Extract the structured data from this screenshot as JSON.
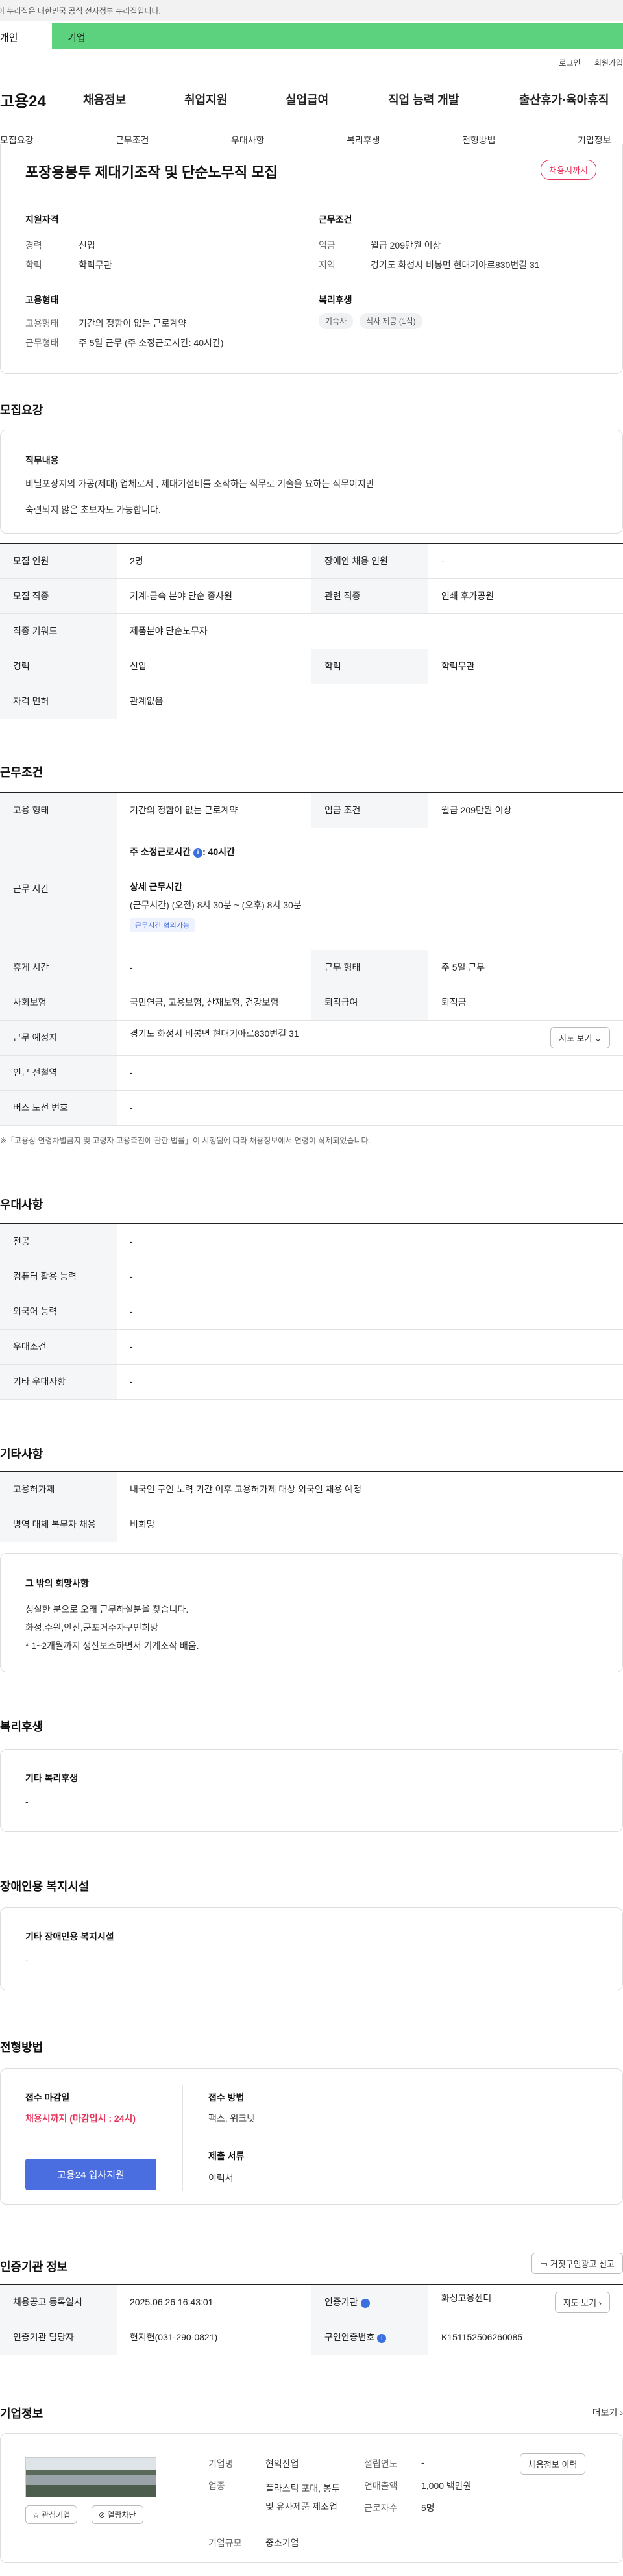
{
  "gov_banner": "이 누리집은 대한민국 공식 전자정부 누리집입니다.",
  "tabs": {
    "person": "개인",
    "company": "기업"
  },
  "util": {
    "login": "로그인",
    "join": "회원가입"
  },
  "logo": "고용24",
  "gnb": [
    "채용정보",
    "취업지원",
    "실업급여",
    "직업 능력 개발",
    "출산휴가·육아휴직"
  ],
  "subnav": [
    "모집요강",
    "근무조건",
    "우대사항",
    "복리후생",
    "전형방법",
    "기업정보"
  ],
  "job": {
    "title": "포장용봉투 제대기조작 및 단순노무직 모집",
    "status_badge": "채용시까지",
    "summary": {
      "qual_title": "지원자격",
      "qual": [
        {
          "k": "경력",
          "v": "신입"
        },
        {
          "k": "학력",
          "v": "학력무관"
        }
      ],
      "cond_title": "근무조건",
      "cond": [
        {
          "k": "임금",
          "v": "월급 209만원 이상"
        },
        {
          "k": "지역",
          "v": "경기도 화성시 비봉면 현대기아로830번길 31"
        }
      ],
      "emp_title": "고용형태",
      "emp": [
        {
          "k": "고용형태",
          "v": "기간의 정함이 없는 근로계약"
        },
        {
          "k": "근무형태",
          "v": "주 5일 근무 (주 소정근로시간: 40시간)"
        }
      ],
      "welfare_title": "복리후생",
      "welfare": [
        "기숙사",
        "식사 제공 (1식)"
      ]
    }
  },
  "recruit": {
    "heading": "모집요강",
    "duty_title": "직무내용",
    "duty_lines": [
      "비닐포장지의 가공(제대) 업체로서 , 제대기설비를 조작하는 직무로 기술을 요하는 직무이지만",
      "숙련되지 않은 초보자도 가능합니다."
    ],
    "rows": [
      {
        "k1": "모집 인원",
        "v1": "2명",
        "k2": "장애인 채용 인원",
        "v2": "-"
      },
      {
        "k1": "모집 직종",
        "v1": "기계·금속 분야 단순 종사원",
        "k2": "관련 직종",
        "v2": "인쇄 후가공원"
      },
      {
        "k1": "직종 키워드",
        "v1": "제품분야 단순노무자"
      },
      {
        "k1": "경력",
        "v1": "신입",
        "k2": "학력",
        "v2": "학력무관"
      },
      {
        "k1": "자격 면허",
        "v1": "관계없음"
      }
    ]
  },
  "work": {
    "heading": "근무조건",
    "emp_type_k": "고용 형태",
    "emp_type_v": "기간의 정함이 없는 근로계약",
    "wage_k": "임금 조건",
    "wage_v": "월급 209만원 이상",
    "hours_k": "근무 시간",
    "hours_label": "주 소정근로시간",
    "hours_value": ": 40시간",
    "hours_detail_title": "상세 근무시간",
    "hours_detail": "(근무시간) (오전) 8시 30분 ~ (오후) 8시 30분",
    "hours_tag": "근무시간 협의가능",
    "rest_k": "휴게 시간",
    "rest_v": "-",
    "shift_k": "근무 형태",
    "shift_v": "주 5일 근무",
    "insure_k": "사회보험",
    "insure_v": "국민연금, 고용보험, 산재보험, 건강보험",
    "retire_k": "퇴직급여",
    "retire_v": "퇴직금",
    "place_k": "근무 예정지",
    "place_v": "경기도 화성시 비봉면 현대기아로830번길 31",
    "map_btn": "지도 보기",
    "subway_k": "인근 전철역",
    "subway_v": "-",
    "bus_k": "버스 노선 번호",
    "bus_v": "-",
    "note": "※「고용상 연령차별금지 및 고령자 고용촉진에 관한 법률」이 시행됨에 따라 채용정보에서 연령이 삭제되었습니다."
  },
  "pref": {
    "heading": "우대사항",
    "rows": [
      {
        "k": "전공",
        "v": "-"
      },
      {
        "k": "컴퓨터 활용 능력",
        "v": "-"
      },
      {
        "k": "외국어 능력",
        "v": "-"
      },
      {
        "k": "우대조건",
        "v": "-"
      },
      {
        "k": "기타 우대사항",
        "v": "-"
      }
    ]
  },
  "etc": {
    "heading": "기타사항",
    "rows": [
      {
        "k": "고용허가제",
        "v": "내국인 구인 노력 기간 이후 고용허가제 대상 외국인 채용 예정"
      },
      {
        "k": "병역 대체 복무자 채용",
        "v": "비희망"
      }
    ],
    "hope_title": "그 밖의 희망사항",
    "hope_lines": [
      "성실한 분으로 오래 근무하실분을 찾습니다.",
      "화성,수원,안산,군포거주자구인희망",
      "* 1~2개월까지 생산보조하면서 기계조작 배움."
    ]
  },
  "welfare": {
    "heading": "복리후생",
    "title": "기타 복리후생",
    "value": "-"
  },
  "disabled": {
    "heading": "장애인용 복지시설",
    "title": "기타 장애인용 복지시설",
    "value": "-"
  },
  "apply": {
    "heading": "전형방법",
    "deadline_title": "접수 마감일",
    "deadline_value": "채용시까지 (마감입시 : 24시)",
    "apply_btn": "고용24 입사지원",
    "method_title": "접수 방법",
    "method_value": "팩스, 워크넷",
    "docs_title": "제출 서류",
    "docs_value": "이력서"
  },
  "cert": {
    "heading": "인증기관 정보",
    "report_btn": "거짓구인광고 신고",
    "rows": [
      {
        "k1": "채용공고 등록일시",
        "v1": "2025.06.26 16:43:01",
        "k2": "인증기관",
        "v2": "화성고용센터",
        "btn": "지도 보기"
      },
      {
        "k1": "인증기관 담당자",
        "v1": "현지현(031-290-0821)",
        "k2": "구인인증번호",
        "v2": "K151152506260085"
      }
    ]
  },
  "company": {
    "heading": "기업정보",
    "more": "더보기",
    "interest_btn": "관심기업",
    "block_btn": "열람차단",
    "fields1": [
      {
        "k": "기업명",
        "v": "현익산업"
      },
      {
        "k": "업종",
        "v": "플라스틱 포대, 봉투 및 유사제품 제조업"
      },
      {
        "k": "기업규모",
        "v": "중소기업"
      }
    ],
    "fields2": [
      {
        "k": "설립연도",
        "v": "-"
      },
      {
        "k": "연매출액",
        "v": "1,000 백만원"
      },
      {
        "k": "근로자수",
        "v": "5명"
      }
    ],
    "recruit_btn": "채용정보 이력"
  }
}
